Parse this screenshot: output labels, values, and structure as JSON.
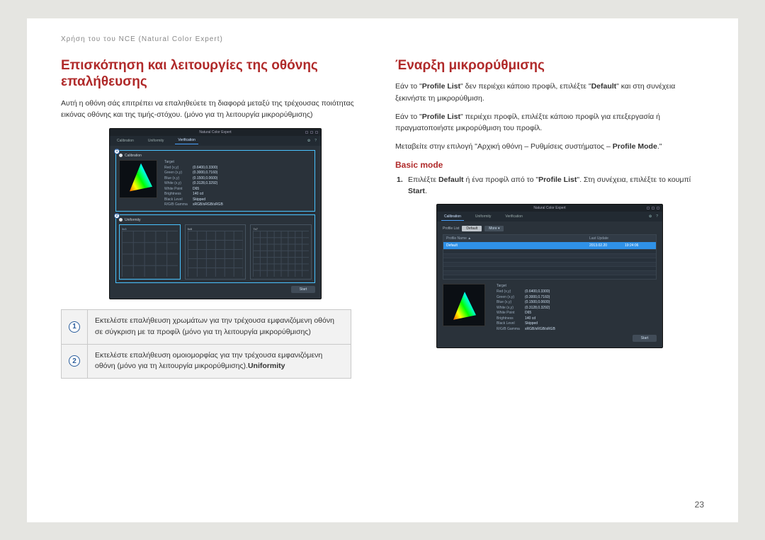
{
  "breadcrumb": "Χρήση του του NCE (Natural Color Expert)",
  "page_number": "23",
  "left": {
    "title": "Επισκόπηση και λειτουργίες της οθόνης επαλήθευσης",
    "intro": "Αυτή η οθόνη σάς επιτρέπει να επαληθεύετε τη διαφορά μεταξύ της τρέχουσας ποιότητας εικόνας οθόνης και της τιμής-στόχου. (μόνο για τη λειτουργία μικρορύθμισης)",
    "app": {
      "title": "Natural Color Expert",
      "tabs": {
        "t1": "Calibration",
        "t2": "Uniformity",
        "t3": "Verification"
      },
      "section1": "Calibration",
      "section2": "Uniformity",
      "target_label": "Target",
      "target_rows": [
        {
          "k": "Red (x,y)",
          "v": "(0.6400,0.3300)"
        },
        {
          "k": "Green (x,y)",
          "v": "(0.3000,0.7160)"
        },
        {
          "k": "Blue (x,y)",
          "v": "(0.1500,0.0600)"
        },
        {
          "k": "White (x,y)",
          "v": "(0.3128,0.3292)"
        },
        {
          "k": "White Point",
          "v": "D65"
        },
        {
          "k": "Brightness",
          "v": "140 cd"
        },
        {
          "k": "Black Level",
          "v": "Skipped"
        },
        {
          "k": "R/G/B Gamma",
          "v": "sRGB/sRGB/sRGB"
        }
      ],
      "grids": [
        "3x3",
        "5x5",
        "7x7"
      ],
      "start": "Start"
    },
    "callouts": [
      "Εκτελέστε επαλήθευση χρωμάτων για την τρέχουσα εμφανιζόμενη οθόνη σε σύγκριση με τα προφίλ (μόνο για τη λειτουργία μικρορύθμισης)",
      "Εκτελέστε επαλήθευση ομοιομορφίας για την τρέχουσα εμφανιζόμενη οθόνη (μόνο για τη λειτουργία μικρορύθμισης)."
    ],
    "callout2_bold": "Uniformity"
  },
  "right": {
    "title": "Έναρξη μικρορύθμισης",
    "p1a": "Εάν το \"",
    "p1b": "Profile List",
    "p1c": "\" δεν περιέχει κάποιο προφίλ, επιλέξτε \"",
    "p1d": "Default",
    "p1e": "\" και στη συνέχεια ξεκινήστε τη μικρορύθμιση.",
    "p2a": "Εάν το \"",
    "p2b": "Profile List",
    "p2c": "\" περιέχει προφίλ, επιλέξτε κάποιο προφίλ για επεξεργασία ή πραγματοποιήστε μικρορύθμιση του προφίλ.",
    "p3a": "Μεταβείτε στην επιλογή \"Αρχική οθόνη – Ρυθμίσεις συστήματος – ",
    "p3b": "Profile Mode",
    "p3c": ".\"",
    "subhead": "Basic mode",
    "step1a": "Επιλέξτε ",
    "step1b": "Default",
    "step1c": " ή ένα προφίλ από το \"",
    "step1d": "Profile List",
    "step1e": "\". Στη συνέχεια, επιλέξτε το κουμπί ",
    "step1f": "Start",
    "step1g": ".",
    "app": {
      "title": "Natural Color Expert",
      "tabs": {
        "t1": "Calibration",
        "t2": "Uniformity",
        "t3": "Verification"
      },
      "profile_list_label": "Profile List",
      "btn_default": "Default",
      "btn_more": "More ▾",
      "col1": "Profile Name ▲",
      "col2": "Last Update",
      "col3": "",
      "row_name": "Default",
      "row_date": "2013.02.20",
      "row_time": "19:24:06",
      "target_label": "Target",
      "target_rows": [
        {
          "k": "Red (x,y)",
          "v": "(0.6400,0.3300)"
        },
        {
          "k": "Green (x,y)",
          "v": "(0.3000,0.7160)"
        },
        {
          "k": "Blue (x,y)",
          "v": "(0.1500,0.0600)"
        },
        {
          "k": "White (x,y)",
          "v": "(0.3128,0.3292)"
        },
        {
          "k": "White Point",
          "v": "D65"
        },
        {
          "k": "Brightness",
          "v": "140 cd"
        },
        {
          "k": "Black Level",
          "v": "Skipped"
        },
        {
          "k": "R/G/B Gamma",
          "v": "sRGB/sRGB/sRGB"
        }
      ],
      "start": "Start"
    }
  }
}
